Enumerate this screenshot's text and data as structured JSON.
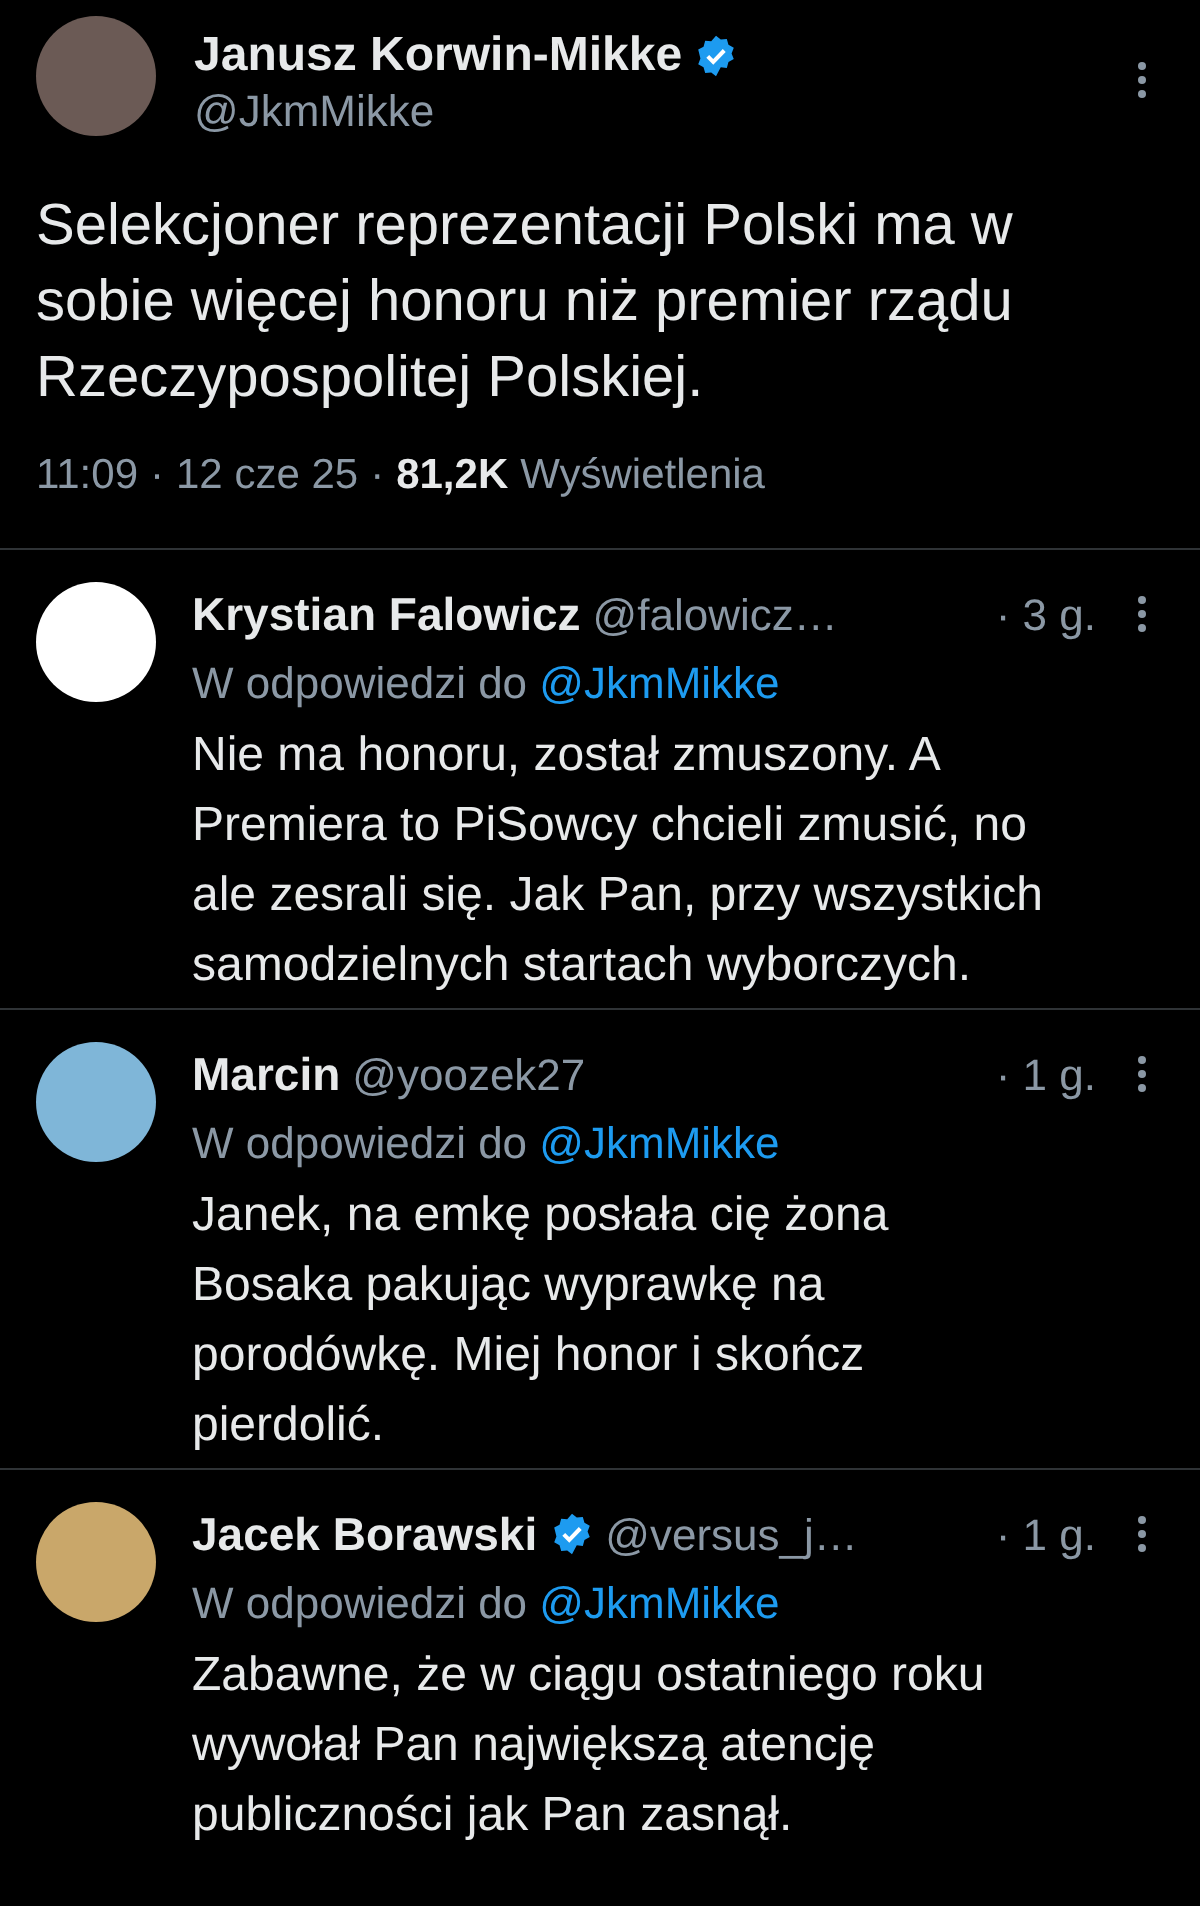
{
  "tweet": {
    "author": {
      "name": "Janusz Korwin-Mikke",
      "verified": true,
      "handle": "@JkmMikke"
    },
    "text_lines": [
      "Selekcjoner reprezentacji Polski ma w",
      "sobie więcej honoru niż premier rządu",
      "Rzeczypospolitej Polskiej."
    ],
    "meta": {
      "time": "11:09",
      "separator": "·",
      "date": "12 cze 25",
      "views": "81,2K",
      "views_label": "Wyświetlenia"
    }
  },
  "replies": [
    {
      "name": "Krystian Falowicz",
      "verified": false,
      "handle": "@falowicz…",
      "time": "· 3 g.",
      "reply_prefix": "W odpowiedzi do",
      "reply_to": "@JkmMikke",
      "text_lines": [
        "Nie ma honoru, został zmuszony. A",
        "Premiera to PiSowcy chcieli zmusić, no",
        "ale zesrali się. Jak Pan, przy wszystkich",
        "samodzielnych startach wyborczych."
      ]
    },
    {
      "name": "Marcin",
      "verified": false,
      "handle": "@yoozek27",
      "time": "· 1 g.",
      "reply_prefix": "W odpowiedzi do",
      "reply_to": "@JkmMikke",
      "text_lines": [
        "Janek, na emkę posłała cię żona",
        "Bosaka pakując wyprawkę na",
        "porodówkę. Miej honor i skończ",
        "pierdolić."
      ]
    },
    {
      "name": "Jacek Borawski",
      "verified": true,
      "handle": "@versus_j…",
      "time": "· 1 g.",
      "reply_prefix": "W odpowiedzi do",
      "reply_to": "@JkmMikke",
      "text_lines": [
        "Zabawne, że w ciągu ostatniego roku",
        "wywołał Pan największą atencję",
        "publiczności jak Pan zasnął."
      ]
    }
  ]
}
